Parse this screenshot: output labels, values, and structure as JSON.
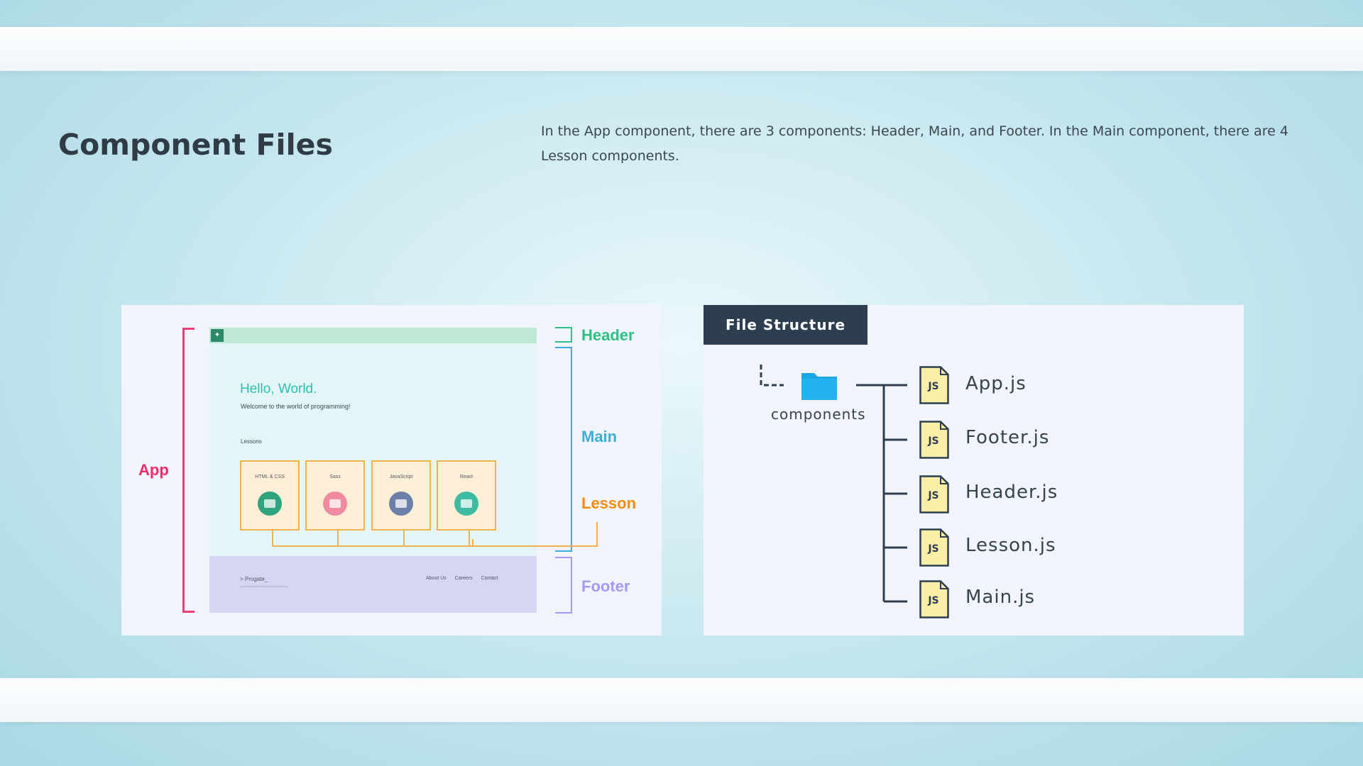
{
  "page": {
    "title": "Component Files",
    "description": "In the App component, there are 3 components: Header, Main, and Footer. In the Main component, there are 4 Lesson components."
  },
  "diagram": {
    "labels": {
      "app": "App",
      "header": "Header",
      "main": "Main",
      "lesson": "Lesson",
      "footer": "Footer"
    },
    "mockup": {
      "hello": "Hello, World.",
      "welcome": "Welcome to the world of programming!",
      "lessons_heading": "Lessons",
      "cards": [
        {
          "title": "HTML & CSS",
          "color": "#2fa37d"
        },
        {
          "title": "Sass",
          "color": "#ef8aa0"
        },
        {
          "title": "JavaScript",
          "color": "#6b7fa8"
        },
        {
          "title": "React",
          "color": "#3dbba3"
        }
      ],
      "footer_brand": "> Progate_",
      "footer_links": [
        "About Us",
        "Careers",
        "Contact"
      ]
    },
    "colors": {
      "app": "#ec2d6c",
      "header": "#2fbf85",
      "main": "#3aaed8",
      "lesson": "#f08c10",
      "footer": "#a39af0"
    }
  },
  "file_structure": {
    "tab_label": "File Structure",
    "folder_name": "components",
    "file_icon_text": "JS",
    "files": [
      "App.js",
      "Footer.js",
      "Header.js",
      "Lesson.js",
      "Main.js"
    ],
    "colors": {
      "tab": "#2d3e51",
      "folder": "#1ea5e3",
      "file_icon": "#fbefa8"
    }
  }
}
